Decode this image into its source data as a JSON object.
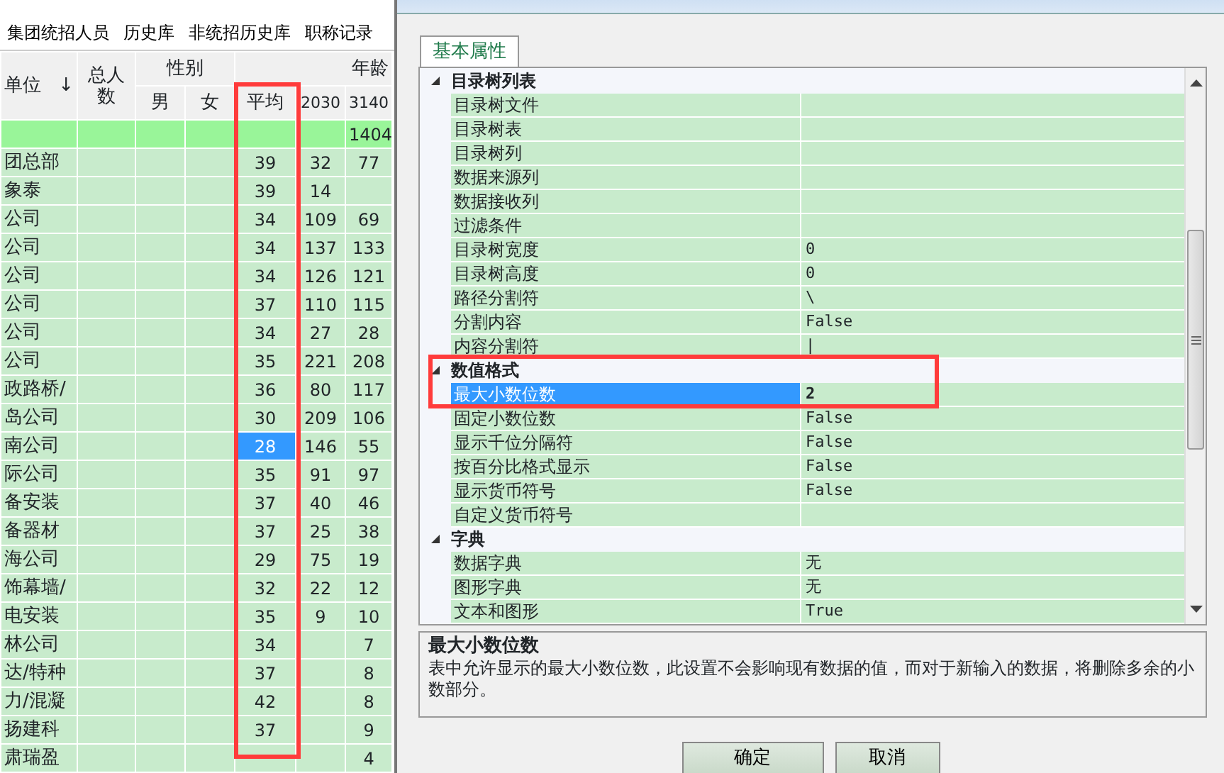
{
  "left_panel": {
    "menu": [
      "集团统招人员",
      "历史库",
      "非统招历史库",
      "职称记录"
    ],
    "table": {
      "header": {
        "unit": "单位",
        "sort_indicator": "↓",
        "total": "总人数",
        "gender": {
          "label": "性别",
          "columns": [
            "男",
            "女"
          ]
        },
        "age": {
          "label": "年龄",
          "columns": [
            "平均",
            "2030",
            "3140"
          ]
        }
      },
      "total_row": {
        "age_3140": "1404"
      },
      "rows": [
        {
          "unit": "团总部",
          "avg": "39",
          "age_2030": "32",
          "age_3140": "77",
          "avg_selected": false
        },
        {
          "unit": "象泰",
          "avg": "39",
          "age_2030": "14",
          "avg_selected": false
        },
        {
          "unit": "公司",
          "avg": "34",
          "age_2030": "109",
          "age_3140": "69",
          "avg_selected": false
        },
        {
          "unit": "公司",
          "avg": "34",
          "age_2030": "137",
          "age_3140": "133",
          "avg_selected": false
        },
        {
          "unit": "公司",
          "avg": "34",
          "age_2030": "126",
          "age_3140": "121",
          "avg_selected": false
        },
        {
          "unit": "公司",
          "avg": "37",
          "age_2030": "110",
          "age_3140": "115",
          "avg_selected": false
        },
        {
          "unit": "公司",
          "avg": "34",
          "age_2030": "27",
          "age_3140": "28",
          "avg_selected": false
        },
        {
          "unit": "公司",
          "avg": "35",
          "age_2030": "221",
          "age_3140": "208",
          "avg_selected": false
        },
        {
          "unit": "政路桥/",
          "avg": "36",
          "age_2030": "80",
          "age_3140": "117",
          "avg_selected": false
        },
        {
          "unit": "岛公司",
          "avg": "30",
          "age_2030": "209",
          "age_3140": "106",
          "avg_selected": false
        },
        {
          "unit": "南公司",
          "avg": "28",
          "age_2030": "146",
          "age_3140": "55",
          "avg_selected": true
        },
        {
          "unit": "际公司",
          "avg": "35",
          "age_2030": "91",
          "age_3140": "97",
          "avg_selected": false
        },
        {
          "unit": "备安装",
          "avg": "37",
          "age_2030": "40",
          "age_3140": "46",
          "avg_selected": false
        },
        {
          "unit": "备器材",
          "avg": "37",
          "age_2030": "25",
          "age_3140": "38",
          "avg_selected": false
        },
        {
          "unit": "海公司",
          "avg": "29",
          "age_2030": "75",
          "age_3140": "19",
          "avg_selected": false
        },
        {
          "unit": "饰幕墙/",
          "avg": "32",
          "age_2030": "22",
          "age_3140": "12",
          "avg_selected": false
        },
        {
          "unit": "电安装",
          "avg": "35",
          "age_2030": "9",
          "age_3140": "10",
          "avg_selected": false
        },
        {
          "unit": "林公司",
          "avg": "34",
          "age_3140": "7",
          "avg_selected": false
        },
        {
          "unit": "达/特种",
          "avg": "37",
          "age_3140": "8",
          "avg_selected": false
        },
        {
          "unit": "力/混凝",
          "avg": "42",
          "age_3140": "8",
          "avg_selected": false
        },
        {
          "unit": "扬建科",
          "avg": "37",
          "age_3140": "9",
          "avg_selected": false
        },
        {
          "unit": "肃瑞盈",
          "age_3140": "4",
          "avg_selected": false
        }
      ]
    }
  },
  "dialog": {
    "tabs": [
      {
        "label": "基本属性",
        "selected": true
      }
    ],
    "property_grid": {
      "categories": [
        {
          "name": "目录树列表",
          "expanded": true,
          "properties": [
            {
              "name": "目录树文件",
              "selected": false
            },
            {
              "name": "目录树表",
              "selected": false
            },
            {
              "name": "目录树列",
              "selected": false
            },
            {
              "name": "数据来源列",
              "selected": false
            },
            {
              "name": "数据接收列",
              "selected": false
            },
            {
              "name": "过滤条件",
              "selected": false
            },
            {
              "name": "目录树宽度",
              "value": "0",
              "selected": false
            },
            {
              "name": "目录树高度",
              "value": "0",
              "selected": false
            },
            {
              "name": "路径分割符",
              "value": "\\",
              "selected": false
            },
            {
              "name": "分割内容",
              "value": "False",
              "selected": false
            },
            {
              "name": "内容分割符",
              "value": "|",
              "selected": false
            }
          ]
        },
        {
          "name": "数值格式",
          "expanded": true,
          "properties": [
            {
              "name": "最大小数位数",
              "value": "2",
              "selected": true
            },
            {
              "name": "固定小数位数",
              "value": "False",
              "selected": false
            },
            {
              "name": "显示千位分隔符",
              "value": "False",
              "selected": false
            },
            {
              "name": "按百分比格式显示",
              "value": "False",
              "selected": false
            },
            {
              "name": "显示货币符号",
              "value": "False",
              "selected": false
            },
            {
              "name": "自定义货币符号",
              "selected": false
            }
          ]
        },
        {
          "name": "字典",
          "expanded": true,
          "properties": [
            {
              "name": "数据字典",
              "value": "无",
              "selected": false
            },
            {
              "name": "图形字典",
              "value": "无",
              "selected": false
            },
            {
              "name": "文本和图形",
              "value": "True",
              "selected": false
            }
          ]
        }
      ]
    },
    "description": {
      "title": "最大小数位数",
      "text": "表中允许显示的最大小数位数，此设置不会影响现有数据的值，而对于新输入的数据，将删除多余的小数部分。"
    },
    "buttons": [
      "确定",
      "取消"
    ]
  }
}
